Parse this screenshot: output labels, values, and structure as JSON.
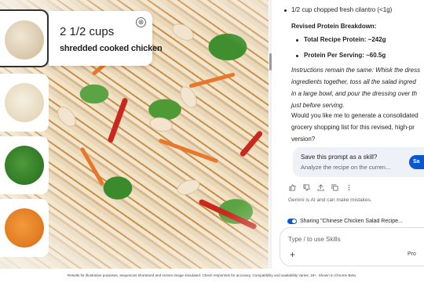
{
  "callout": {
    "quantity": "2 1/2 cups",
    "ingredient": "shredded cooked chicken",
    "close_symbol": "⊗"
  },
  "chat": {
    "top_bullet": "1/2 cup chopped fresh cilantro (<1g)",
    "breakdown_heading": "Revised Protein Breakdown:",
    "total_protein": "Total Recipe Protein: ~242g",
    "per_serving": "Protein Per Serving: ~60.5g",
    "instructions": [
      "Instructions remain the same: Whisk the dress",
      "ingredients together, toss all the salad ingred",
      "in a large bowl, and pour the dressing over th",
      "just before serving."
    ],
    "question": [
      "Would you like me to generate a consolidated",
      "grocery shopping list for this revised, high-pr",
      "version?"
    ],
    "prompt_card": {
      "title": "Save this prompt as a skill?",
      "subtitle": "Analyze the recipe on the curren...",
      "button": "Sa"
    },
    "disclaimer": "Gemini is AI and can make mistakes.",
    "sharing": "Sharing \"Chinese Chicken Salad Recipe...",
    "input_placeholder": "Type / to use Skills",
    "model_label": "Pro"
  },
  "icons": [
    "thumbs-up-icon",
    "thumbs-down-icon",
    "share-icon",
    "copy-icon",
    "more-icon",
    "plus-icon",
    "close-icon"
  ],
  "footer": "Results for illustrative purposes, sequences shortened and screen image simulated. Check responses for accuracy. Compatibility and availability varies. 18+. Shown in Chrome Beta.",
  "colors": {
    "accent": "#0b57d0",
    "prompt_card_bg": "#eef1f7"
  }
}
